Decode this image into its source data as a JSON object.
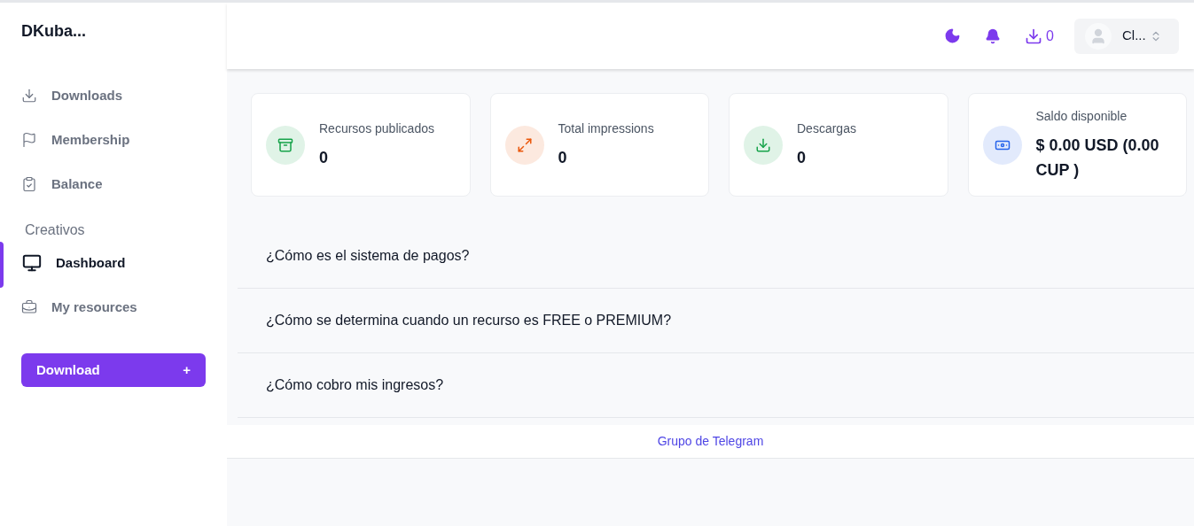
{
  "brand": "DKuba...",
  "sidebar": {
    "items": [
      {
        "label": "Downloads",
        "kind": "download",
        "selected": false
      },
      {
        "label": "Membership",
        "kind": "flag",
        "selected": false
      },
      {
        "label": "Balance",
        "kind": "clipboard",
        "selected": false
      }
    ],
    "section": {
      "title": "Creativos",
      "items": [
        {
          "label": "Dashboard",
          "kind": "monitor",
          "selected": true
        },
        {
          "label": "My resources",
          "kind": "briefcase",
          "selected": false
        }
      ]
    },
    "button": {
      "label": "Download",
      "icon": "+"
    }
  },
  "header": {
    "download_count": "0",
    "user": {
      "name": "Cl..."
    }
  },
  "stats": [
    {
      "label": "Recursos publicados",
      "value": "0",
      "kind": "box",
      "color": "#16a34a"
    },
    {
      "label": "Total impressions",
      "value": "0",
      "kind": "expand",
      "color": "#ea580c"
    },
    {
      "label": "Descargas",
      "value": "0",
      "kind": "download",
      "color": "#16a34a"
    },
    {
      "label": "Saldo disponible",
      "value": "$ 0.00 USD (0.00 CUP )",
      "kind": "cash",
      "color": "#2563eb"
    }
  ],
  "faq": [
    {
      "question": "¿Cómo es el sistema de pagos?"
    },
    {
      "question": "¿Cómo se determina cuando un recurso es FREE o PREMIUM?"
    },
    {
      "question": "¿Cómo cobro mis ingresos?"
    }
  ],
  "footer": {
    "link": "Grupo de Telegram"
  }
}
